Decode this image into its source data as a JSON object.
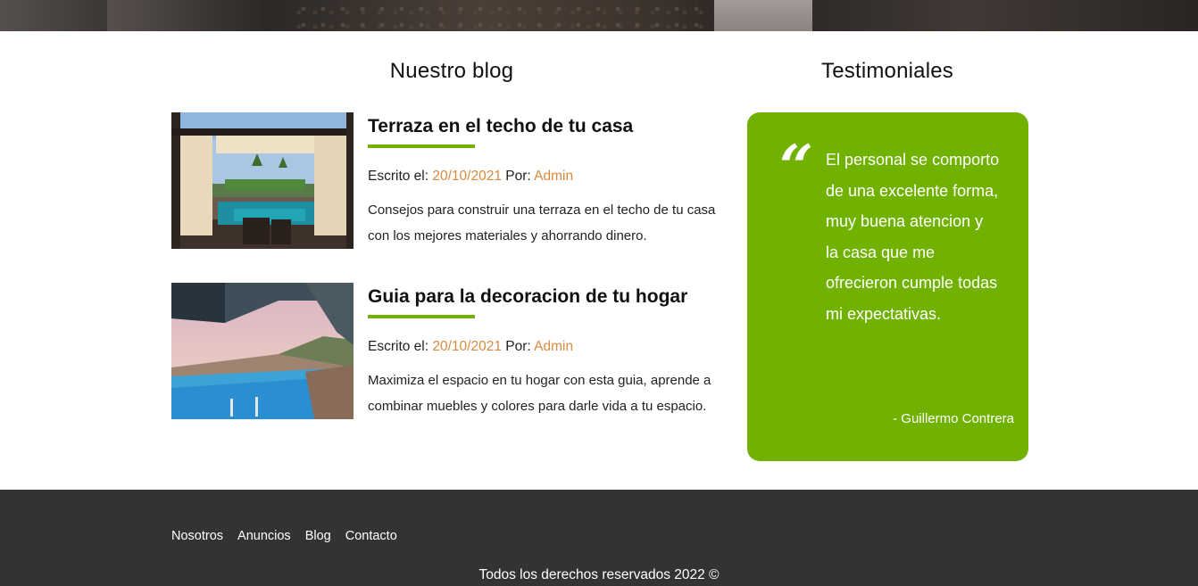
{
  "blog": {
    "heading": "Nuestro blog",
    "entries": [
      {
        "title": "Terraza en el techo de tu casa",
        "meta_prefix": "Escrito el: ",
        "date": "20/10/2021",
        "by_label": " Por: ",
        "author": "Admin",
        "excerpt": "Consejos para construir una terraza en el techo de tu casa con los mejores materiales y ahorrando dinero."
      },
      {
        "title": "Guia para la decoracion de tu hogar",
        "meta_prefix": "Escrito el: ",
        "date": "20/10/2021",
        "by_label": " Por: ",
        "author": "Admin",
        "excerpt": "Maximiza el espacio en tu hogar con esta guia, aprende a combinar muebles y colores para darle vida a tu espacio."
      }
    ]
  },
  "testimonials": {
    "heading": "Testimoniales",
    "quote_mark": "“",
    "text": "El personal se comporto de una excelente forma, muy buena atencion y la casa que me ofrecieron cumple todas mi expectativas.",
    "author": "- Guillermo Contrera"
  },
  "footer": {
    "nav": [
      "Nosotros",
      "Anuncios",
      "Blog",
      "Contacto"
    ],
    "copyright": "Todos los derechos reservados 2022 ©"
  },
  "colors": {
    "accent_green": "#71b100",
    "accent_orange": "#d88a3e",
    "footer_bg": "#333333"
  }
}
